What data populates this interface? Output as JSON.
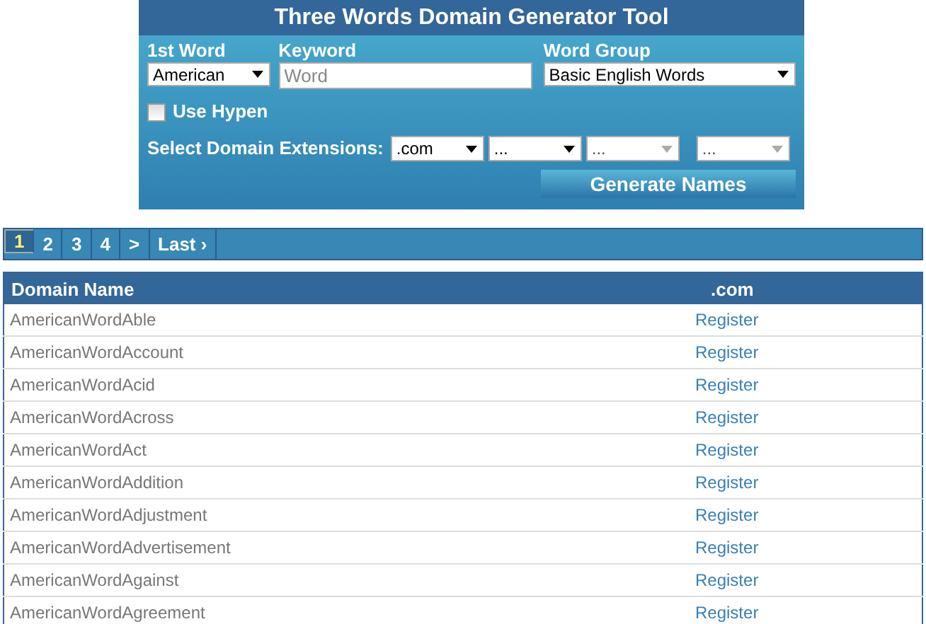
{
  "tool": {
    "title": "Three Words Domain Generator Tool",
    "first_word": {
      "label": "1st Word",
      "value": "American"
    },
    "keyword": {
      "label": "Keyword",
      "placeholder": "Word"
    },
    "word_group": {
      "label": "Word Group",
      "value": "Basic English Words"
    },
    "use_hyphen": {
      "label": "Use Hypen",
      "checked": false
    },
    "extensions_label": "Select Domain Extensions:",
    "extensions": [
      {
        "value": ".com",
        "disabled": false
      },
      {
        "value": "...",
        "disabled": false
      },
      {
        "value": "...",
        "disabled": true
      },
      {
        "value": "...",
        "disabled": true
      }
    ],
    "generate_button": "Generate Names"
  },
  "pager": [
    {
      "label": "1",
      "selected": true
    },
    {
      "label": "2",
      "selected": false
    },
    {
      "label": "3",
      "selected": false
    },
    {
      "label": "4",
      "selected": false
    },
    {
      "label": ">",
      "selected": false
    },
    {
      "label": "Last ›",
      "selected": false
    }
  ],
  "table": {
    "columns": [
      "Domain Name",
      ".com"
    ],
    "rows": [
      [
        "AmericanWordAble",
        "Register"
      ],
      [
        "AmericanWordAccount",
        "Register"
      ],
      [
        "AmericanWordAcid",
        "Register"
      ],
      [
        "AmericanWordAcross",
        "Register"
      ],
      [
        "AmericanWordAct",
        "Register"
      ],
      [
        "AmericanWordAddition",
        "Register"
      ],
      [
        "AmericanWordAdjustment",
        "Register"
      ],
      [
        "AmericanWordAdvertisement",
        "Register"
      ],
      [
        "AmericanWordAgainst",
        "Register"
      ],
      [
        "AmericanWordAgreement",
        "Register"
      ]
    ]
  }
}
